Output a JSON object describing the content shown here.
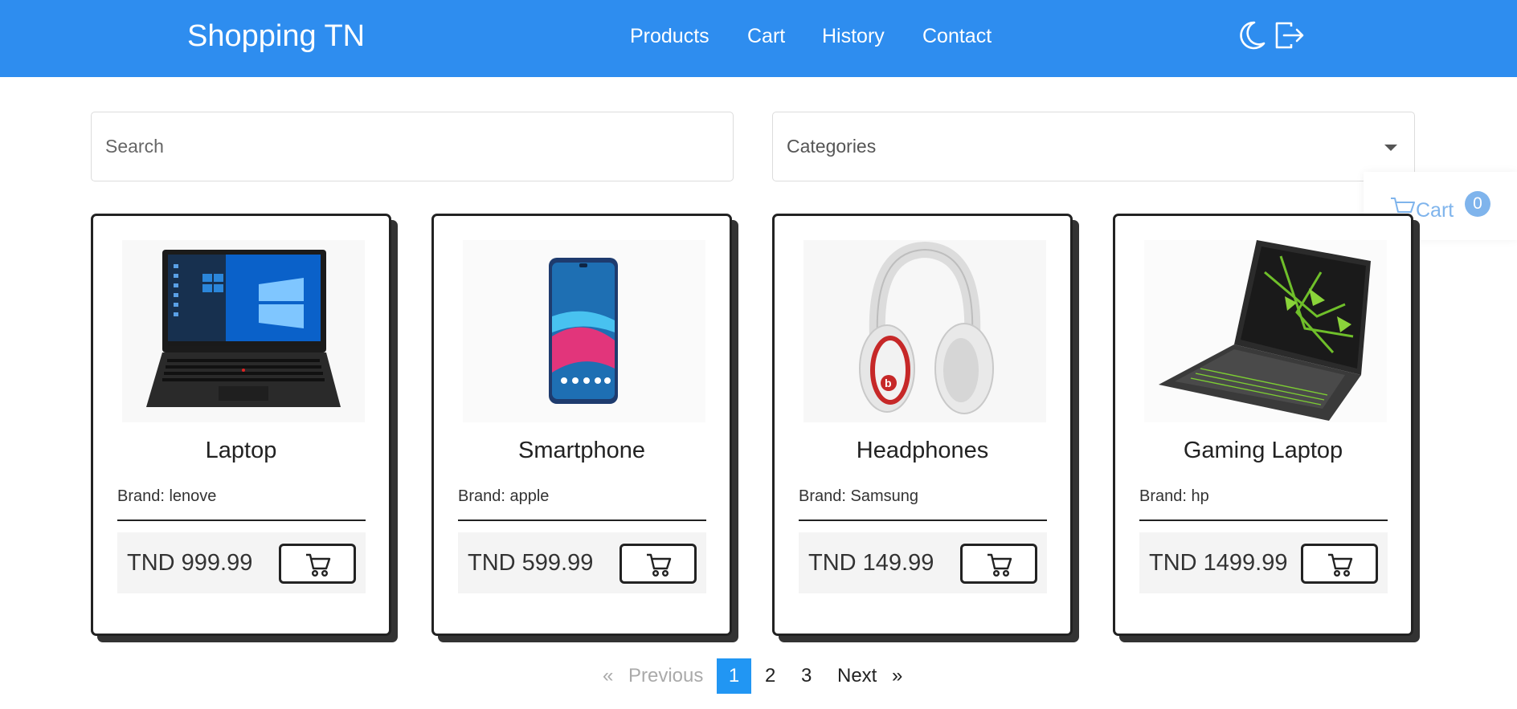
{
  "header": {
    "brand": "Shopping TN",
    "nav": [
      {
        "label": "Products"
      },
      {
        "label": "Cart"
      },
      {
        "label": "History"
      },
      {
        "label": "Contact"
      }
    ],
    "icons": [
      "moon-icon",
      "logout-icon"
    ],
    "background": "#2e8def"
  },
  "filters": {
    "search_placeholder": "Search",
    "search_value": "",
    "categories_selected": "Categories"
  },
  "float_cart": {
    "label": "Cart",
    "count": "0"
  },
  "products": [
    {
      "name": "Laptop",
      "brand": "Brand: lenove",
      "price": "TND 999.99",
      "image": "laptop-image"
    },
    {
      "name": "Smartphone",
      "brand": "Brand: apple",
      "price": "TND 599.99",
      "image": "smartphone-image"
    },
    {
      "name": "Headphones",
      "brand": "Brand: Samsung",
      "price": "TND 149.99",
      "image": "headphones-image"
    },
    {
      "name": "Gaming Laptop",
      "brand": "Brand: hp",
      "price": "TND 1499.99",
      "image": "gaming-laptop-image"
    }
  ],
  "pagination": {
    "prev_arrow": "«",
    "prev_label": "Previous",
    "pages": [
      "1",
      "2",
      "3"
    ],
    "current": "1",
    "next_label": "Next",
    "next_arrow": "»",
    "active_color": "#2196f3"
  }
}
